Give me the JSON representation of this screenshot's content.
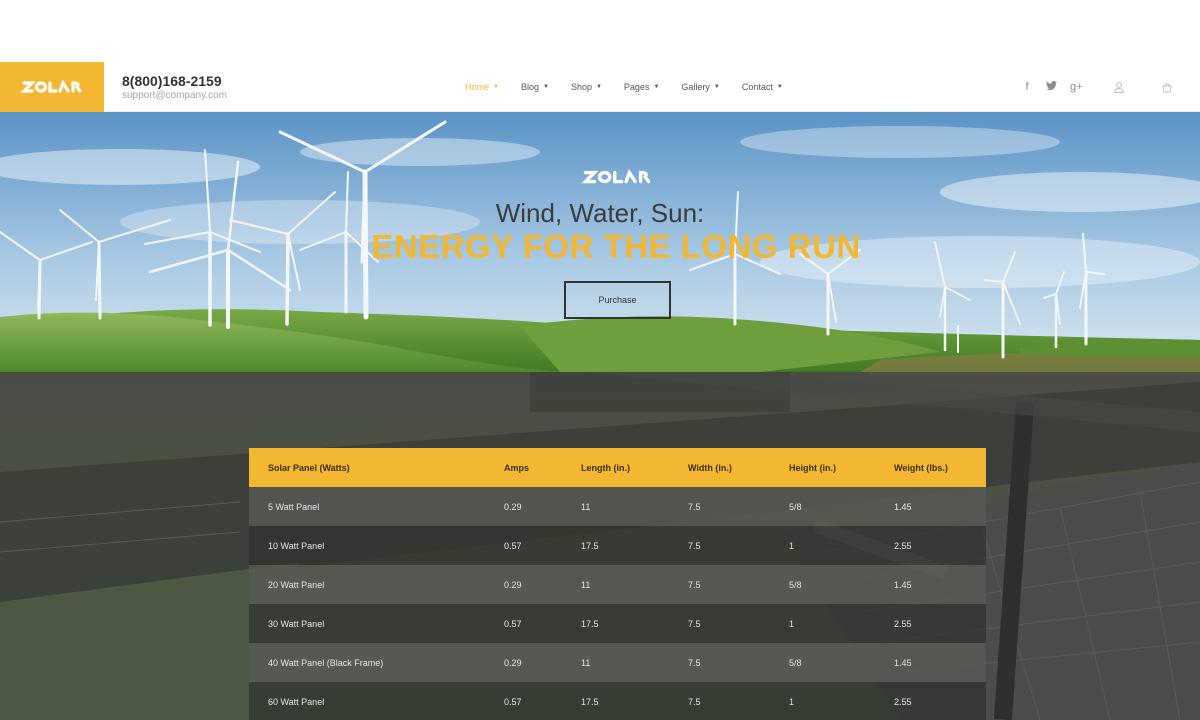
{
  "header": {
    "phone": "8(800)168-2159",
    "email": "support@company.com",
    "logo_text": "SOLAR",
    "nav": [
      {
        "label": "Home",
        "active": true
      },
      {
        "label": "Blog",
        "active": false
      },
      {
        "label": "Shop",
        "active": false
      },
      {
        "label": "Pages",
        "active": false
      },
      {
        "label": "Gallery",
        "active": false
      },
      {
        "label": "Contact",
        "active": false
      }
    ],
    "social": [
      {
        "icon": "facebook-icon",
        "glyph": "f"
      },
      {
        "icon": "twitter-icon",
        "glyph": "✦"
      },
      {
        "icon": "google-plus-icon",
        "glyph": "g+"
      }
    ],
    "accent_color": "#f4b731"
  },
  "hero": {
    "title": "Wind, Water, Sun:",
    "subtitle": "ENERGY FOR THE LONG RUN",
    "button_label": "Purchase"
  },
  "table": {
    "headers": [
      "Solar Panel (Watts)",
      "Amps",
      "Length (in.)",
      "Width (in.)",
      "Height (in.)",
      "Weight (lbs.)"
    ],
    "rows": [
      [
        "5 Watt Panel",
        "0.29",
        "11",
        "7.5",
        "5/8",
        "1.45"
      ],
      [
        "10 Watt Panel",
        "0.57",
        "17.5",
        "7.5",
        "1",
        "2.55"
      ],
      [
        "20 Watt Panel",
        "0.29",
        "11",
        "7.5",
        "5/8",
        "1.45"
      ],
      [
        "30 Watt Panel",
        "0.57",
        "17.5",
        "7.5",
        "1",
        "2.55"
      ],
      [
        "40 Watt Panel (Black Frame)",
        "0.29",
        "11",
        "7.5",
        "5/8",
        "1.45"
      ],
      [
        "60 Watt Panel",
        "0.57",
        "17.5",
        "7.5",
        "1",
        "2.55"
      ]
    ]
  }
}
